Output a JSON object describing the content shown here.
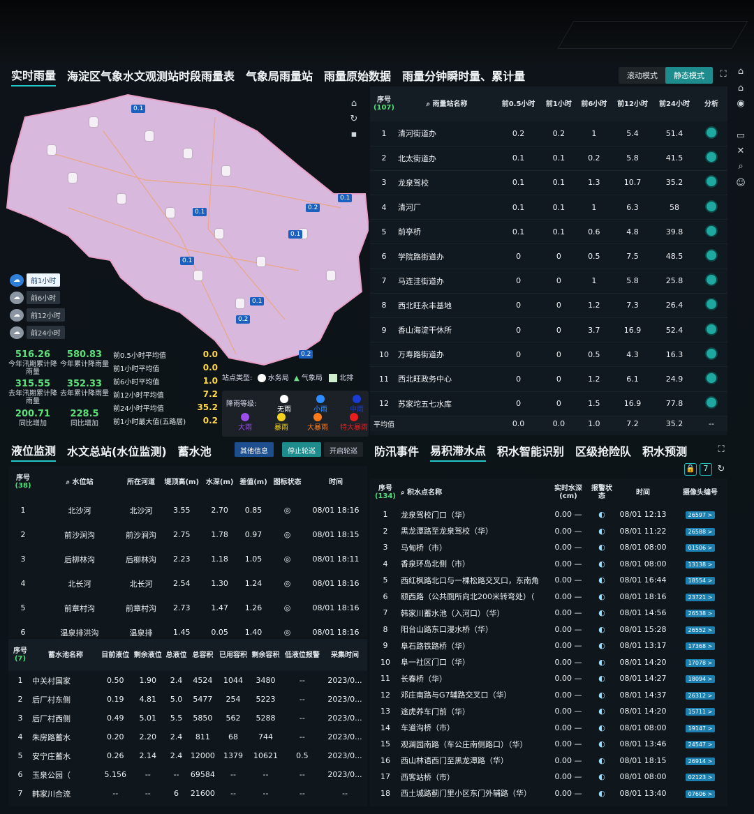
{
  "top_tabs": [
    "实时雨量",
    "海淀区气象水文观测站时段雨量表",
    "气象局雨量站",
    "雨量原始数据",
    "雨量分钟瞬时量、累计量"
  ],
  "mode": {
    "scroll": "滚动模式",
    "static": "静态模式"
  },
  "map": {
    "value_pins": [
      "0.1",
      "0.1",
      "0.2",
      "0.1",
      "0.1",
      "0.1",
      "0.1",
      "0.2",
      "0.2"
    ],
    "legend_periods": [
      "前1小时",
      "前6小时",
      "前12小时",
      "前24小时"
    ],
    "stats": [
      {
        "v": "516.26",
        "l": "今年汛期累计降雨量"
      },
      {
        "v": "580.83",
        "l": "今年累计降雨量"
      },
      {
        "v": "315.55",
        "l": "去年汛期累计降雨量"
      },
      {
        "v": "352.33",
        "l": "去年累计降雨量"
      },
      {
        "v": "200.71",
        "l": "同比增加"
      },
      {
        "v": "228.5",
        "l": "同比增加"
      }
    ],
    "averages": [
      {
        "l": "前0.5小时平均值",
        "v": "0.0"
      },
      {
        "l": "前1小时平均值",
        "v": "0.0"
      },
      {
        "l": "前6小时平均值",
        "v": "1.0"
      },
      {
        "l": "前12小时平均值",
        "v": "7.2"
      },
      {
        "l": "前24小时平均值",
        "v": "35.2"
      },
      {
        "l": "前1小时最大值(五路居)",
        "v": "0.2"
      }
    ],
    "station_types_label": "站点类型:",
    "station_types": [
      "水务局",
      "气象局",
      "北排"
    ],
    "rain_levels_label": "降雨等级:",
    "rain_levels": [
      "无雨",
      "小雨",
      "中雨",
      "大雨",
      "暴雨",
      "大暴雨",
      "特大暴雨"
    ],
    "rain_level_colors": [
      "#ffffff",
      "#2d8cff",
      "#1a3bd6",
      "#9b4ee8",
      "#f3d21d",
      "#ff7a1a",
      "#e81e1e"
    ]
  },
  "rain_table": {
    "headers": [
      "序号",
      "雨量站名称",
      "前0.5小时",
      "前1小时",
      "前6小时",
      "前12小时",
      "前24小时",
      "分析"
    ],
    "count": "(107)",
    "rows": [
      [
        "1",
        "清河街道办",
        "0.2",
        "0.2",
        "1",
        "5.4",
        "51.4"
      ],
      [
        "2",
        "北太街道办",
        "0.1",
        "0.1",
        "0.2",
        "5.8",
        "41.5"
      ],
      [
        "3",
        "龙泉驾校",
        "0.1",
        "0.1",
        "1.3",
        "10.7",
        "35.2"
      ],
      [
        "4",
        "清河厂",
        "0.1",
        "0.1",
        "1",
        "6.3",
        "58"
      ],
      [
        "5",
        "前亭桥",
        "0.1",
        "0.1",
        "0.6",
        "4.8",
        "39.8"
      ],
      [
        "6",
        "学院路街道办",
        "0",
        "0",
        "0.5",
        "7.5",
        "48.5"
      ],
      [
        "7",
        "马连洼街道办",
        "0",
        "0",
        "1",
        "5.8",
        "25.8"
      ],
      [
        "8",
        "西北旺永丰基地",
        "0",
        "0",
        "1.2",
        "7.3",
        "26.4"
      ],
      [
        "9",
        "香山海淀干休所",
        "0",
        "0",
        "3.7",
        "16.9",
        "52.4"
      ],
      [
        "10",
        "万寿路街道办",
        "0",
        "0",
        "0.5",
        "4.3",
        "16.3"
      ],
      [
        "11",
        "西北旺政务中心",
        "0",
        "0",
        "1.2",
        "6.1",
        "24.9"
      ],
      [
        "12",
        "苏家坨五七水库",
        "0",
        "0",
        "1.5",
        "16.9",
        "77.8"
      ]
    ],
    "avg_row": [
      "平均值",
      "0.0",
      "0.0",
      "1.0",
      "7.2",
      "35.2",
      "--"
    ]
  },
  "mid_tabs_left": [
    "液位监测",
    "水文总站(水位监测)",
    "蓄水池"
  ],
  "mid_buttons": [
    "其他信息",
    "停止轮巡",
    "开启轮巡"
  ],
  "mid_tabs_right": [
    "防汛事件",
    "易积滞水点",
    "积水智能识别",
    "区级抢险队",
    "积水预测"
  ],
  "level_table": {
    "count": "(38)",
    "headers": [
      "序号",
      "水位站",
      "所在河道",
      "堤顶高(m)",
      "水深(m)",
      "差值(m)",
      "图标状态",
      "时间"
    ],
    "rows": [
      [
        "1",
        "北沙河",
        "北沙河",
        "3.55",
        "2.70",
        "0.85",
        "08/01 18:16"
      ],
      [
        "2",
        "前沙涧沟",
        "前沙涧沟",
        "2.75",
        "1.78",
        "0.97",
        "08/01 18:15"
      ],
      [
        "3",
        "后柳林沟",
        "后柳林沟",
        "2.23",
        "1.18",
        "1.05",
        "08/01 18:11"
      ],
      [
        "4",
        "北长河",
        "北长河",
        "2.54",
        "1.30",
        "1.24",
        "08/01 18:16"
      ],
      [
        "5",
        "前章村沟",
        "前章村沟",
        "2.73",
        "1.47",
        "1.26",
        "08/01 18:16"
      ],
      [
        "6",
        "温泉排洪沟",
        "温泉排",
        "1.45",
        "0.05",
        "1.40",
        "08/01 18:16"
      ]
    ]
  },
  "pool_table": {
    "count": "(7)",
    "headers": [
      "序号",
      "蓄水池名称",
      "目前液位",
      "剩余液位",
      "总液位",
      "总容积",
      "已用容积",
      "剩余容积",
      "低液位报警",
      "采集时间"
    ],
    "rows": [
      [
        "1",
        "中关村国家",
        "0.50",
        "1.90",
        "2.4",
        "4524",
        "1044",
        "3480",
        "--",
        "2023/0..."
      ],
      [
        "2",
        "后厂村东侧",
        "0.19",
        "4.81",
        "5.0",
        "5477",
        "254",
        "5223",
        "--",
        "2023/0..."
      ],
      [
        "3",
        "后厂村西侧",
        "0.49",
        "5.01",
        "5.5",
        "5850",
        "562",
        "5288",
        "--",
        "2023/0..."
      ],
      [
        "4",
        "朱房路蓄水",
        "0.20",
        "2.20",
        "2.4",
        "811",
        "68",
        "744",
        "--",
        "2023/0..."
      ],
      [
        "5",
        "安宁庄蓄水",
        "0.26",
        "2.14",
        "2.4",
        "12000",
        "1379",
        "10621",
        "0.5",
        "2023/0..."
      ],
      [
        "6",
        "玉泉公园（",
        "5.156",
        "--",
        "--",
        "69584",
        "--",
        "--",
        "--",
        "2023/0..."
      ],
      [
        "7",
        "韩家川合流",
        "--",
        "--",
        "6",
        "21600",
        "--",
        "--",
        "--",
        "--"
      ]
    ]
  },
  "water_table": {
    "count": "(134)",
    "badge": "7",
    "headers": [
      "序号",
      "积水点名称",
      "实时水深(cm)",
      "报警状态",
      "时间",
      "摄像头编号"
    ],
    "rows": [
      [
        "1",
        "龙泉驾校门口（华）",
        "0.00 —",
        "08/01 12:13",
        "26597 >"
      ],
      [
        "2",
        "黑龙潭路至龙泉驾校（华）",
        "0.00 —",
        "08/01 11:22",
        "26588 >"
      ],
      [
        "3",
        "马甸桥（市）",
        "0.00 —",
        "08/01 08:00",
        "01506 >"
      ],
      [
        "4",
        "香泉环岛北侧（市）",
        "0.00 —",
        "08/01 08:00",
        "13138 >"
      ],
      [
        "5",
        "西红枫路北口与一棵松路交叉口，东南角",
        "0.00 —",
        "08/01 16:44",
        "18554 >"
      ],
      [
        "6",
        "颐西路（公共厕所向北200米转弯处）（",
        "0.00 —",
        "08/01 18:16",
        "23721 >"
      ],
      [
        "7",
        "韩家川蓄水池（入河口）（华）",
        "0.00 —",
        "08/01 14:56",
        "26538 >"
      ],
      [
        "8",
        "阳台山路东口漫水桥（华）",
        "0.00 —",
        "08/01 15:28",
        "26552 >"
      ],
      [
        "9",
        "阜石路铁路桥（华）",
        "0.00 —",
        "08/01 13:17",
        "17368 >"
      ],
      [
        "10",
        "阜一社区门口（华）",
        "0.00 —",
        "08/01 14:20",
        "17078 >"
      ],
      [
        "11",
        "长春桥（华）",
        "0.00 —",
        "08/01 14:27",
        "18094 >"
      ],
      [
        "12",
        "邓庄南路与G7辅路交叉口（华）",
        "0.00 —",
        "08/01 14:37",
        "26312 >"
      ],
      [
        "13",
        "途虎养车门前（华）",
        "0.00 —",
        "08/01 14:20",
        "15711 >"
      ],
      [
        "14",
        "车道沟桥（市）",
        "0.00 —",
        "08/01 08:00",
        "19147 >"
      ],
      [
        "15",
        "观澜园南路（车公庄南侧路口）（华）",
        "0.00 —",
        "08/01 13:46",
        "24547 >"
      ],
      [
        "16",
        "西山林语西门至黑龙潭路（华）",
        "0.00 —",
        "08/01 18:15",
        "26914 >"
      ],
      [
        "17",
        "西客站桥（市）",
        "0.00 —",
        "08/01 08:00",
        "02123 >"
      ],
      [
        "18",
        "西土城路蓟门里小区东门外辅路（华）",
        "0.00 —",
        "08/01 13:40",
        "07606 >"
      ]
    ]
  }
}
